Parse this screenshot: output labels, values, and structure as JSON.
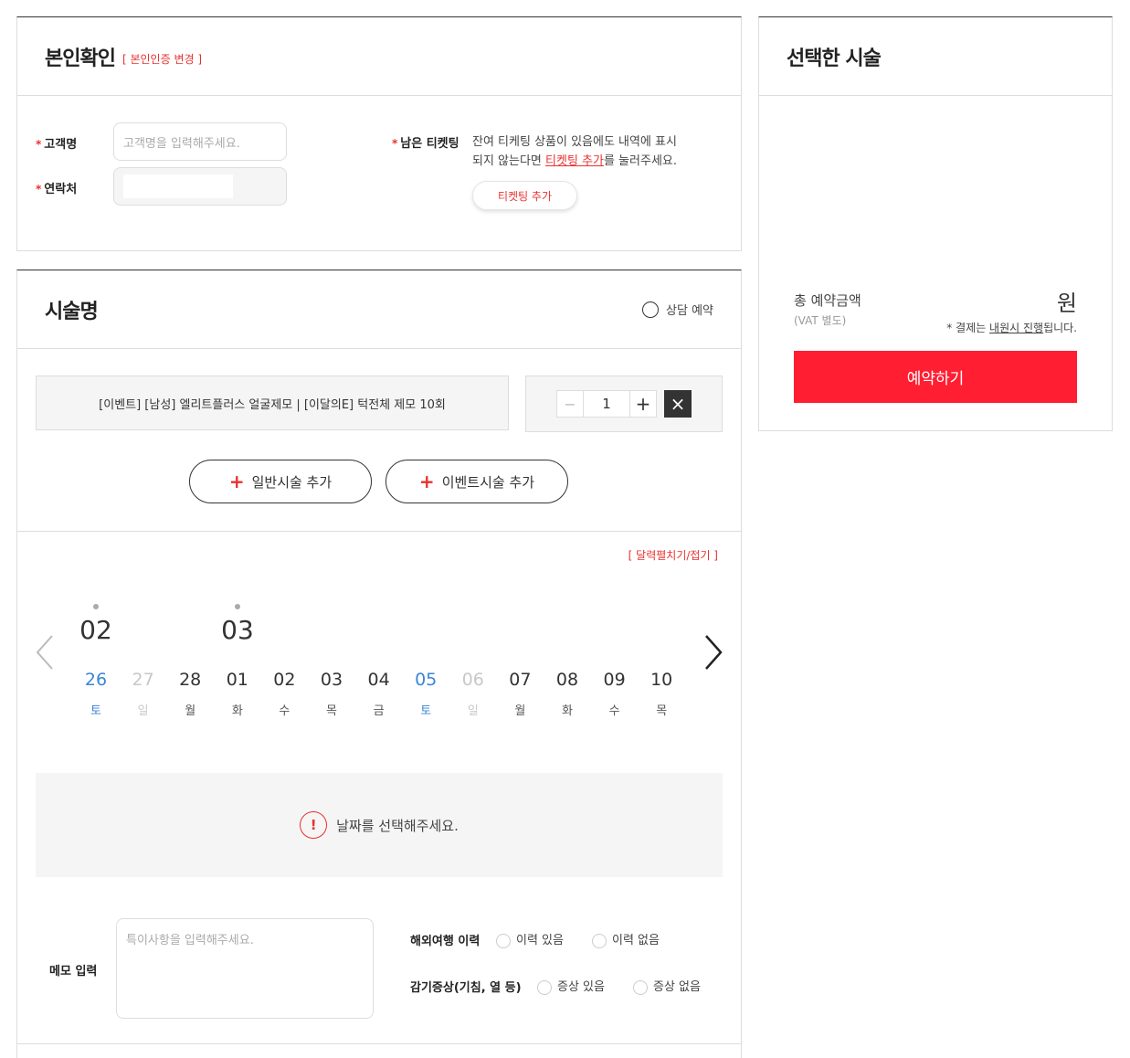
{
  "identity": {
    "title": "본인확인",
    "change_link": "[ 본인인증 변경 ]",
    "name_label": "고객명",
    "name_placeholder": "고객명을 입력해주세요.",
    "phone_label": "연락처",
    "ticket_label": "남은 티켓팅",
    "ticket_desc_1": "잔여 티케팅 상품이 있음에도 내역에 표시",
    "ticket_desc_2a": "되지 않는다면 ",
    "ticket_desc_link": "티켓팅 추가",
    "ticket_desc_2b": "를 눌러주세요.",
    "ticket_button": "티켓팅 추가"
  },
  "procedure": {
    "title": "시술명",
    "consult_label": "상담 예약",
    "item_text": "[이벤트] [남성] 엘리트플러스 얼굴제모 | [이달의E] 턱전체 제모 10회",
    "quantity": "1",
    "minus": "−",
    "plus": "+",
    "remove": "×",
    "add_general": "일반시술 추가",
    "add_event": "이벤트시술 추가",
    "add_icon": "+"
  },
  "calendar": {
    "toggle_label": "[ 달력펼치기/접기 ]",
    "months": [
      "02",
      "03"
    ],
    "days": [
      {
        "n": "26",
        "w": "토",
        "type": "sat"
      },
      {
        "n": "27",
        "w": "일",
        "type": "sun"
      },
      {
        "n": "28",
        "w": "월",
        "type": ""
      },
      {
        "n": "01",
        "w": "화",
        "type": ""
      },
      {
        "n": "02",
        "w": "수",
        "type": ""
      },
      {
        "n": "03",
        "w": "목",
        "type": ""
      },
      {
        "n": "04",
        "w": "금",
        "type": ""
      },
      {
        "n": "05",
        "w": "토",
        "type": "sat"
      },
      {
        "n": "06",
        "w": "일",
        "type": "sun"
      },
      {
        "n": "07",
        "w": "월",
        "type": ""
      },
      {
        "n": "08",
        "w": "화",
        "type": ""
      },
      {
        "n": "09",
        "w": "수",
        "type": ""
      },
      {
        "n": "10",
        "w": "목",
        "type": ""
      }
    ],
    "notice_icon": "!",
    "notice_text": "날짜를 선택해주세요."
  },
  "memo": {
    "label": "메모 입력",
    "placeholder": "특이사항을 입력해주세요.",
    "travel_label": "해외여행 이력",
    "travel_yes": "이력 있음",
    "travel_no": "이력 없음",
    "cold_label": "감기증상(기침, 열 등)",
    "cold_yes": "증상 있음",
    "cold_no": "증상 없음"
  },
  "summary": {
    "title": "선택한 시술",
    "total_label": "총 예약금액",
    "vat_label": "(VAT 별도)",
    "currency": "원",
    "note_prefix": "* 결제는 ",
    "note_link": "내원시 진행",
    "note_suffix": "됩니다.",
    "reserve_button": "예약하기"
  },
  "colors": {
    "accent": "#ff1e32",
    "link_red": "#e8312f",
    "weekend_blue": "#3b86d4"
  }
}
